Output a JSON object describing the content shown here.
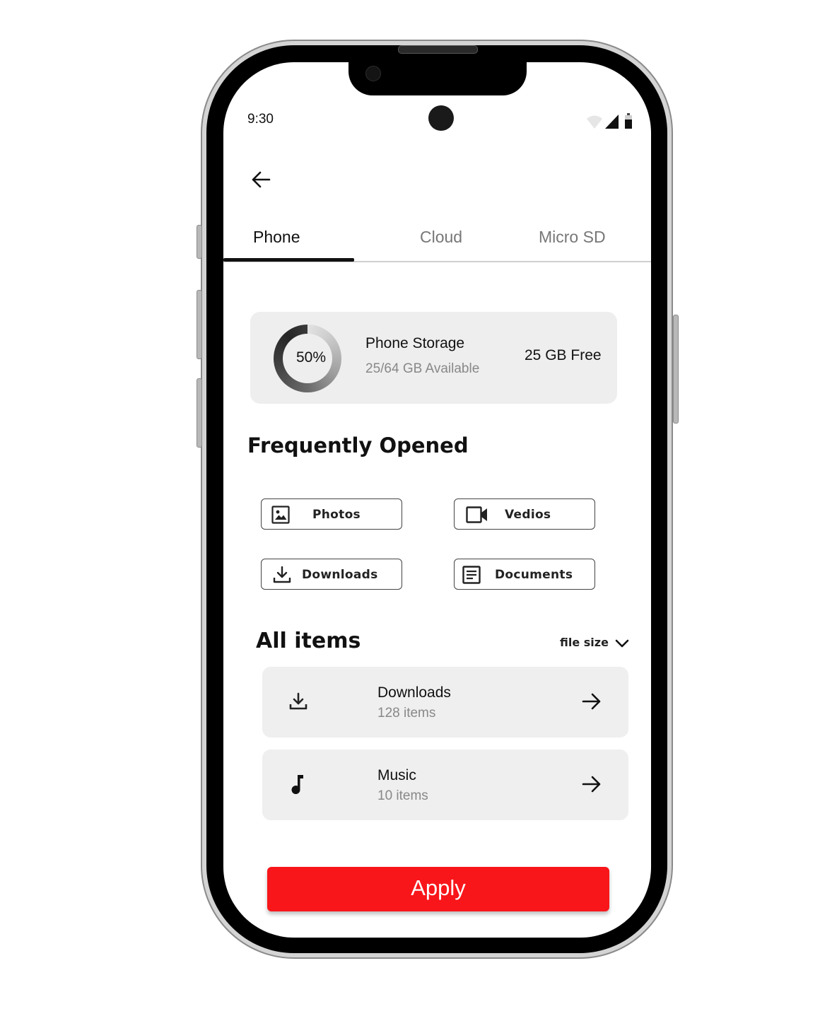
{
  "status_bar": {
    "time": "9:30",
    "icons": [
      "wifi-icon",
      "cellular-signal-icon",
      "battery-icon"
    ]
  },
  "header": {
    "back_icon": "arrow-left-icon"
  },
  "tabs": [
    {
      "label": "Phone",
      "active": true
    },
    {
      "label": "Cloud",
      "active": false
    },
    {
      "label": "Micro SD",
      "active": false
    }
  ],
  "storage": {
    "percent_label": "50%",
    "used_fraction": 0.5,
    "title": "Phone Storage",
    "subtitle": "25/64 GB Available",
    "free": "25 GB Free"
  },
  "frequently_opened": {
    "title": "Frequently Opened",
    "items": [
      {
        "label": "Photos",
        "icon": "image-icon"
      },
      {
        "label": "Vedios",
        "icon": "video-camera-icon"
      },
      {
        "label": "Downloads",
        "icon": "download-icon"
      },
      {
        "label": "Documents",
        "icon": "document-icon"
      }
    ]
  },
  "all_items": {
    "title": "All items",
    "sort_label": "file size",
    "sort_icon": "chevron-down-icon",
    "items": [
      {
        "title": "Downloads",
        "count": "128 items",
        "icon": "download-icon"
      },
      {
        "title": "Music",
        "count": "10 items",
        "icon": "music-note-icon"
      }
    ]
  },
  "apply_button": {
    "label": "Apply",
    "color": "#f8161a"
  },
  "colors": {
    "accent": "#f8161a",
    "card_bg": "#eeeeee",
    "text": "#111111",
    "muted": "#888888"
  }
}
